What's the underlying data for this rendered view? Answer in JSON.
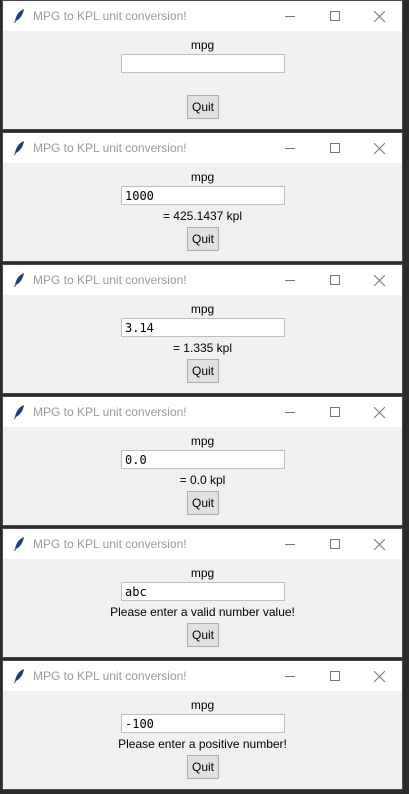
{
  "windows": [
    {
      "title": "MPG to KPL unit conversion!",
      "label": "mpg",
      "input_value": "",
      "result": "",
      "quit_label": "Quit"
    },
    {
      "title": "MPG to KPL unit conversion!",
      "label": "mpg",
      "input_value": "1000",
      "result": "= 425.1437 kpl",
      "quit_label": "Quit"
    },
    {
      "title": "MPG to KPL unit conversion!",
      "label": "mpg",
      "input_value": "3.14",
      "result": "= 1.335 kpl",
      "quit_label": "Quit"
    },
    {
      "title": "MPG to KPL unit conversion!",
      "label": "mpg",
      "input_value": "0.0",
      "result": "= 0.0 kpl",
      "quit_label": "Quit"
    },
    {
      "title": "MPG to KPL unit conversion!",
      "label": "mpg",
      "input_value": "abc",
      "result": "Please enter a valid number value!",
      "quit_label": "Quit"
    },
    {
      "title": "MPG to KPL unit conversion!",
      "label": "mpg",
      "input_value": "-100",
      "result": "Please enter a positive number!",
      "quit_label": "Quit"
    }
  ],
  "icons": {
    "app": "feather-icon",
    "minimize": "minimize-icon",
    "maximize": "maximize-icon",
    "close": "close-icon"
  },
  "colors": {
    "window_bg": "#f0f0f0",
    "titlebar_bg": "#ffffff",
    "title_text": "#9a9a9a",
    "outer_bg": "#2b2b2b"
  }
}
